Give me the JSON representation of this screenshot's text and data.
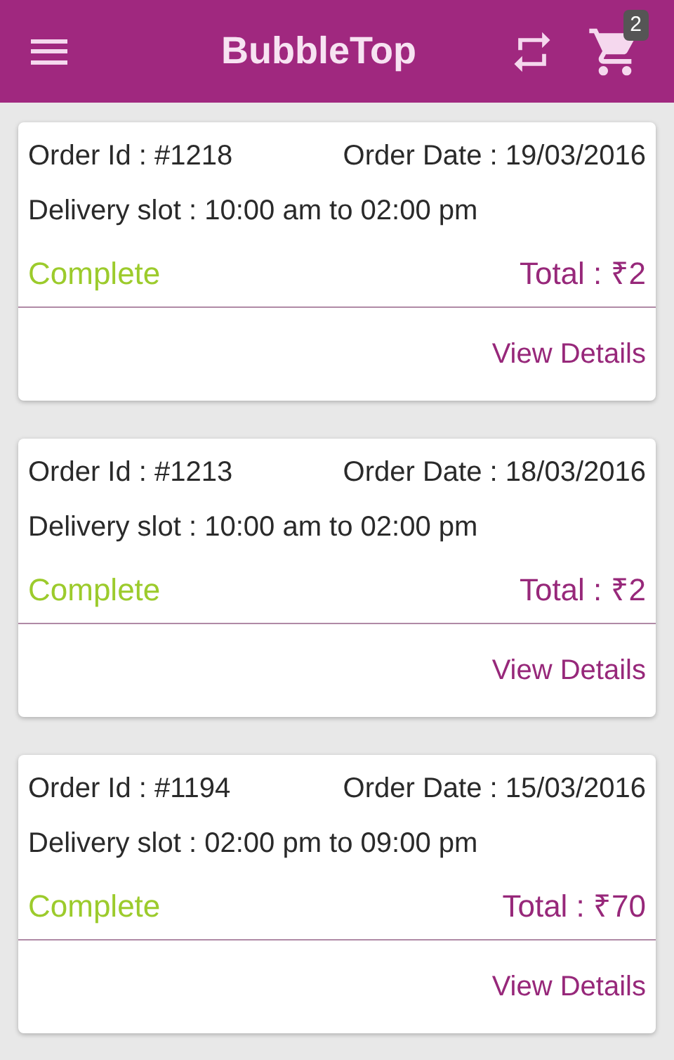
{
  "app_bar": {
    "title": "BubbleTop",
    "cart_count": "2"
  },
  "orders": [
    {
      "order_id": "Order Id : #1218",
      "order_date": "Order Date : 19/03/2016",
      "delivery_slot": "Delivery slot : 10:00 am to 02:00 pm",
      "status": "Complete",
      "total": "Total : ₹2",
      "action": "View Details"
    },
    {
      "order_id": "Order Id : #1213",
      "order_date": "Order Date : 18/03/2016",
      "delivery_slot": "Delivery slot : 10:00 am to 02:00 pm",
      "status": "Complete",
      "total": "Total : ₹2",
      "action": "View Details"
    },
    {
      "order_id": "Order Id : #1194",
      "order_date": "Order Date : 15/03/2016",
      "delivery_slot": "Delivery slot : 02:00 pm to 09:00 pm",
      "status": "Complete",
      "total": "Total : ₹70",
      "action": "View Details"
    }
  ]
}
